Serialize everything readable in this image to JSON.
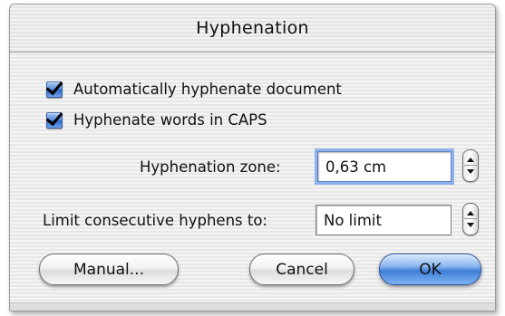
{
  "dialog": {
    "title": "Hyphenation"
  },
  "options": {
    "auto_hyphenate": {
      "label": "Automatically hyphenate document",
      "checked": true
    },
    "hyphenate_caps": {
      "label": "Hyphenate words in CAPS",
      "checked": true
    }
  },
  "hyphenation_zone": {
    "label": "Hyphenation zone:",
    "value": "0,63 cm"
  },
  "consecutive_limit": {
    "label": "Limit consecutive hyphens to:",
    "value": "No limit"
  },
  "buttons": {
    "manual": "Manual...",
    "cancel": "Cancel",
    "ok": "OK"
  },
  "colors": {
    "accent_blue": "#3f7fd8",
    "focus_ring": "#8fb2e8"
  },
  "icons": {
    "checkbox_checked": "checkmark-icon",
    "stepper": "up-down-arrows-icon"
  }
}
